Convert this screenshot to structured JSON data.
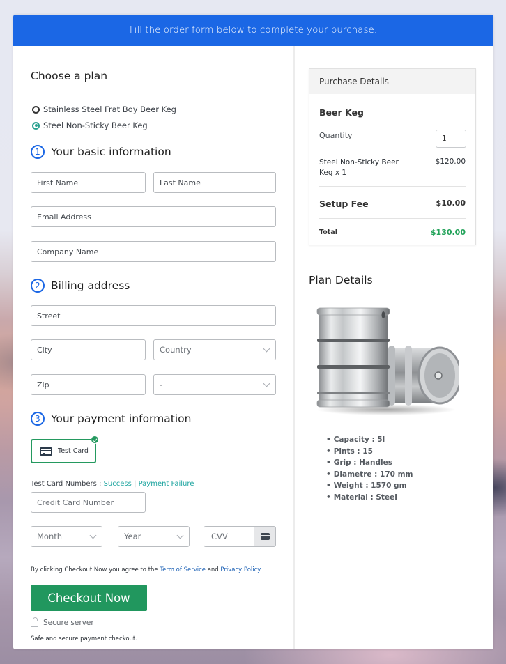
{
  "banner": {
    "text": "Fill the order form below to complete your purchase."
  },
  "plan": {
    "heading": "Choose a plan",
    "options": [
      {
        "label": "Stainless Steel Frat Boy Beer Keg",
        "selected": false
      },
      {
        "label": "Steel Non-Sticky Beer Keg",
        "selected": true
      }
    ]
  },
  "basic": {
    "number": "1",
    "title": "Your basic information",
    "first_name_placeholder": "First Name",
    "last_name_placeholder": "Last Name",
    "email_placeholder": "Email Address",
    "company_placeholder": "Company Name"
  },
  "billing": {
    "number": "2",
    "title": "Billing address",
    "street_placeholder": "Street",
    "city_placeholder": "City",
    "country_selected": "Country",
    "zip_placeholder": "Zip",
    "state_selected": "-"
  },
  "payment": {
    "number": "3",
    "title": "Your payment information",
    "method_label": "Test Card",
    "test_numbers_prefix": "Test Card Numbers : ",
    "success_link": "Success",
    "separator": " | ",
    "failure_link": "Payment Failure",
    "card_number_placeholder": "Credit Card Number",
    "month_selected": "Month",
    "year_selected": "Year",
    "cvv_placeholder": "CVV"
  },
  "agreement": {
    "prefix": "By clicking Checkout Now you agree to the ",
    "terms_link": "Term of Service",
    "and": " and ",
    "privacy_link": "Privacy Policy"
  },
  "checkout": {
    "button_label": "Checkout Now",
    "secure_label": "Secure server",
    "safe_text": "Safe and secure payment checkout."
  },
  "purchase": {
    "header": "Purchase Details",
    "product": "Beer Keg",
    "quantity_label": "Quantity",
    "quantity_value": "1",
    "item_label": "Steel Non-Sticky Beer Keg x 1",
    "item_price": "$120.00",
    "setup_fee_label": "Setup Fee",
    "setup_fee": "$10.00",
    "total_label": "Total",
    "total": "$130.00"
  },
  "plan_details": {
    "title": "Plan Details",
    "image_alt": "Two steel beer kegs",
    "specs": [
      "Capacity : 5l",
      "Pints : 15",
      "Grip : Handles",
      "Diametre : 170 mm",
      "Weight : 1570 gm",
      "Material : Steel"
    ]
  },
  "colors": {
    "banner": "#1b67e5",
    "accent_green": "#21975e",
    "total_green": "#23a35a",
    "radio_teal": "#2aa190",
    "link_teal": "#1ea5a0",
    "link_blue": "#1a5fb4"
  }
}
